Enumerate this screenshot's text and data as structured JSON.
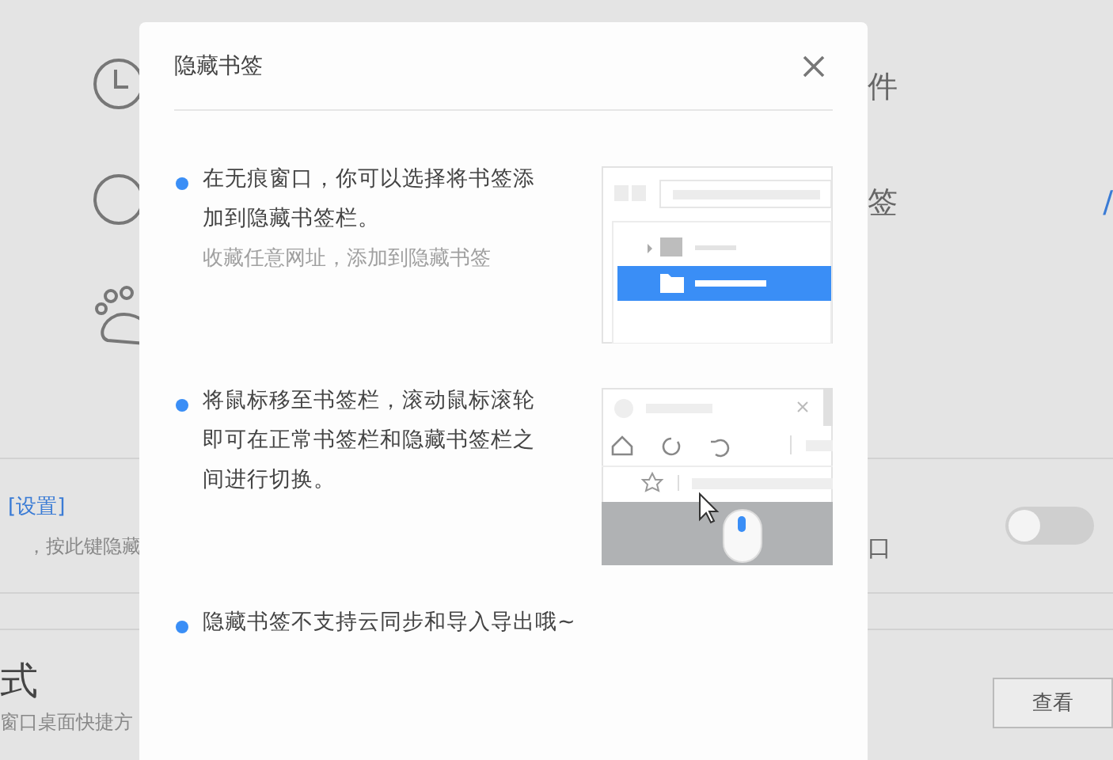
{
  "background": {
    "rows": [
      {
        "tail": "件"
      },
      {
        "tail": "签",
        "link": "/"
      },
      {}
    ],
    "setting": {
      "link": "[设置]",
      "description": "，按此键隐藏",
      "tail": "口",
      "toggle": {
        "on": false
      }
    },
    "shortcut": {
      "title": "式",
      "description": "窗口桌面快捷方",
      "button": "查看"
    }
  },
  "dialog": {
    "title": "隐藏书签",
    "items": [
      {
        "kind": "folder-tree",
        "text": "在无痕窗口，你可以选择将书签添加到隐藏书签栏。",
        "note": "收藏任意网址，添加到隐藏书签"
      },
      {
        "kind": "toolbar-scroll",
        "text": "将鼠标移至书签栏，滚动鼠标滚轮即可在正常书签栏和隐藏书签栏之间进行切换。"
      },
      {
        "kind": "plain",
        "text": "隐藏书签不支持云同步和导入导出哦~"
      }
    ]
  }
}
